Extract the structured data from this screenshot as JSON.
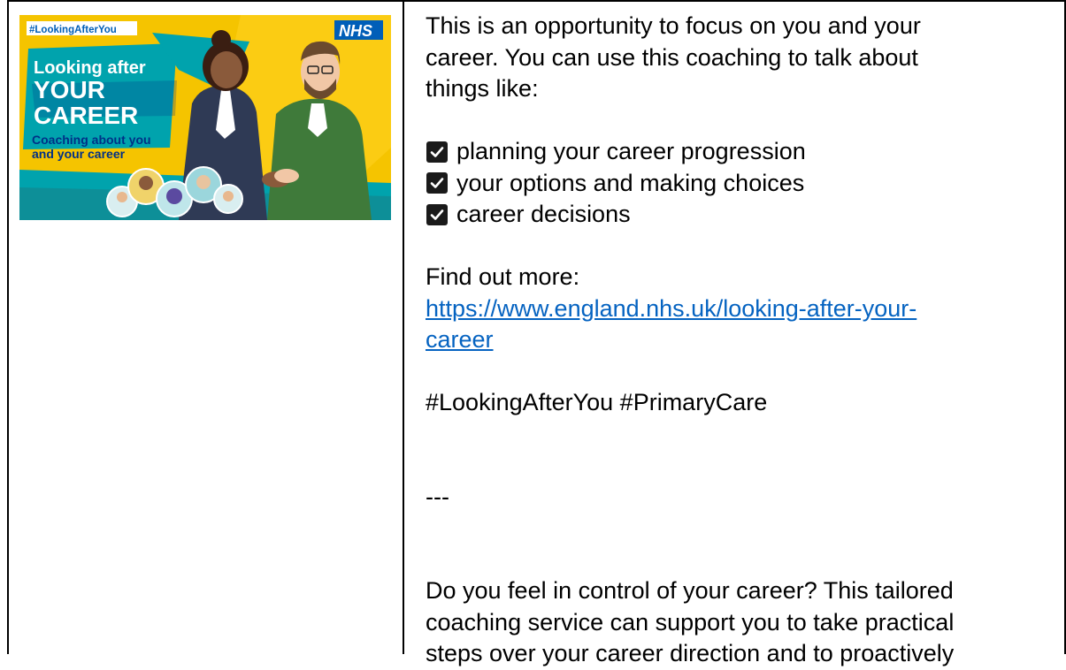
{
  "image": {
    "hashtag": "#LookingAfterYou",
    "nhs": "NHS",
    "heading_line1": "Looking after",
    "heading_line2": "YOUR",
    "heading_line3": "CAREER",
    "sub_line1": "Coaching about you",
    "sub_line2": "and your career",
    "colors": {
      "yellow": "#f5c400",
      "teal": "#00a3ad",
      "nhs_blue": "#005eb8",
      "navy": "#003087"
    }
  },
  "content": {
    "intro_line1": "This is an opportunity to focus on you and your",
    "intro_line2": "career. You can use this coaching to talk about",
    "intro_line3": "things like:",
    "bullets": [
      "planning your career progression",
      "your options and making choices",
      "career decisions"
    ],
    "find_out_label": "Find out more:",
    "link_line1": "https://www.england.nhs.uk/looking-after-your-",
    "link_line2": "career",
    "hashtags": "#LookingAfterYou #PrimaryCare",
    "separator": "---",
    "para2_line1": "Do you feel in control of your career? This tailored",
    "para2_line2": "coaching service can support you to take practical",
    "para2_line3": "steps over your career direction and to proactively"
  }
}
